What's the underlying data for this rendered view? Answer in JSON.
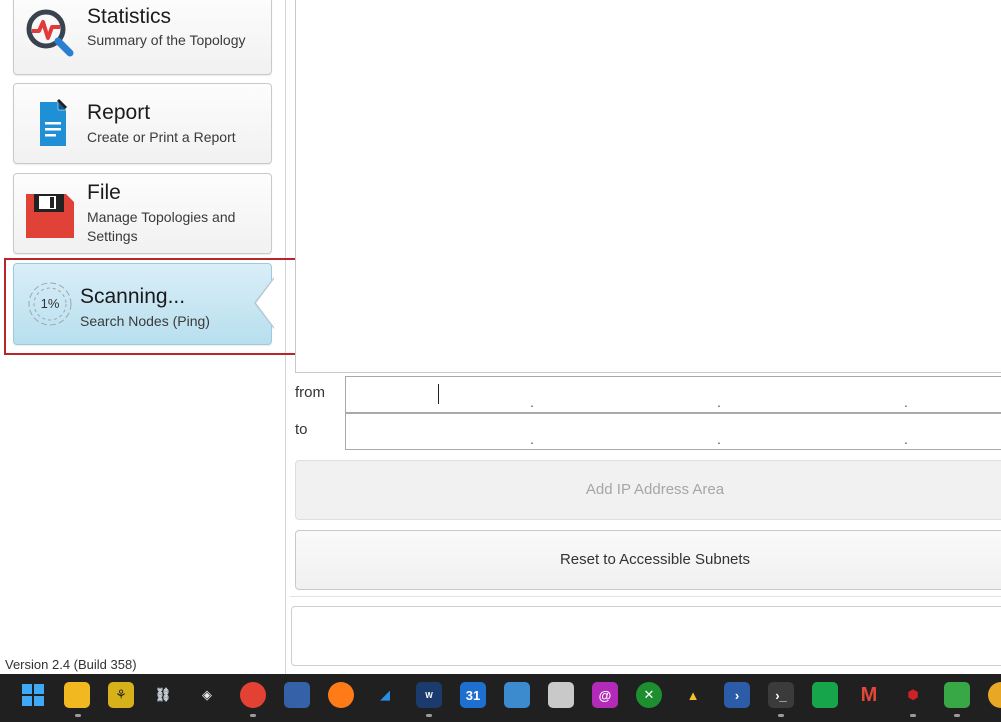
{
  "sidebar": {
    "cards": [
      {
        "title": "Statistics",
        "subtitle": "Summary of the Topology",
        "icon": "statistics-icon"
      },
      {
        "title": "Report",
        "subtitle": "Create or Print a Report",
        "icon": "report-icon"
      },
      {
        "title": "File",
        "subtitle": "Manage Topologies and Settings",
        "icon": "file-floppy-icon"
      },
      {
        "title": "Scanning...",
        "subtitle": "Search Nodes (Ping)",
        "icon": "progress-ring-icon",
        "progress_label": "1%",
        "progress": 0.01
      }
    ],
    "version": "Version 2.4 (Build 358)"
  },
  "ip_range": {
    "from_label": "from",
    "to_label": "to",
    "separator": "."
  },
  "buttons": {
    "add_area": "Add IP Address Area",
    "reset": "Reset to Accessible Subnets"
  },
  "colors": {
    "active_card": "#b8dfee",
    "highlight": "#b8262b",
    "taskbar": "#202020"
  },
  "taskbar": {
    "icons": [
      "windows-start-icon",
      "file-explorer-icon",
      "app-icon",
      "network-icon",
      "virtualbox-icon",
      "chrome-profile-icon",
      "network-tool-icon",
      "firefox-icon",
      "wireshark-icon",
      "works-icon",
      "calendar-icon",
      "remote-desktop-icon",
      "terminal-app-icon",
      "at-icon",
      "xbox-icon",
      "google-drive-icon",
      "powershell-icon",
      "terminal-icon",
      "chat-icon",
      "gmail-icon",
      "cube-icon",
      "app-green-icon",
      "chrome-icon"
    ],
    "calendar_day": "31"
  }
}
